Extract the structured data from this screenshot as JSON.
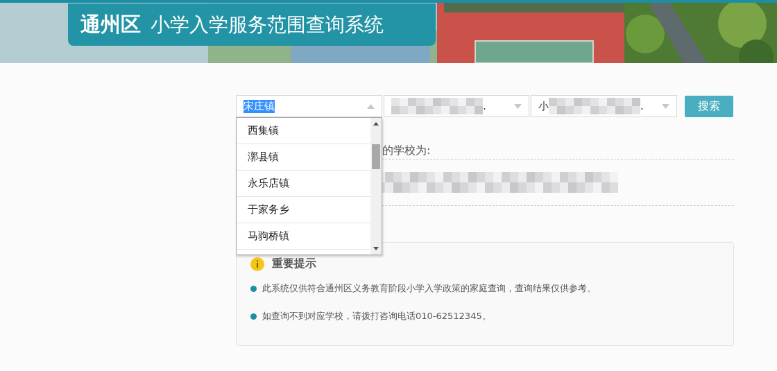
{
  "header": {
    "district": "通州区",
    "title": "小学入学服务范围查询系统"
  },
  "search": {
    "selects": [
      {
        "kind": "plain",
        "value": "宋庄镇",
        "highlighted": true,
        "open": true
      },
      {
        "kind": "redacted",
        "value_end": ".",
        "highlighted": false,
        "open": false
      },
      {
        "kind": "redacted",
        "value_start": "小",
        "value_end": ".",
        "highlighted": false,
        "open": false
      }
    ],
    "button": "搜索"
  },
  "dropdown": {
    "options": [
      {
        "label": "西集镇"
      },
      {
        "label": "漷县镇"
      },
      {
        "label": "永乐店镇"
      },
      {
        "label": "于家务乡"
      },
      {
        "label": "马驹桥镇"
      }
    ]
  },
  "result": {
    "label_end": "的学校为:",
    "redacted": true
  },
  "notice": {
    "title": "重要提示",
    "items": [
      "此系统仅供符合通州区义务教育阶段小学入学政策的家庭查询，查询结果仅供参考。",
      "如查询不到对应学校，请拨打咨询电话010-62512345。"
    ]
  }
}
